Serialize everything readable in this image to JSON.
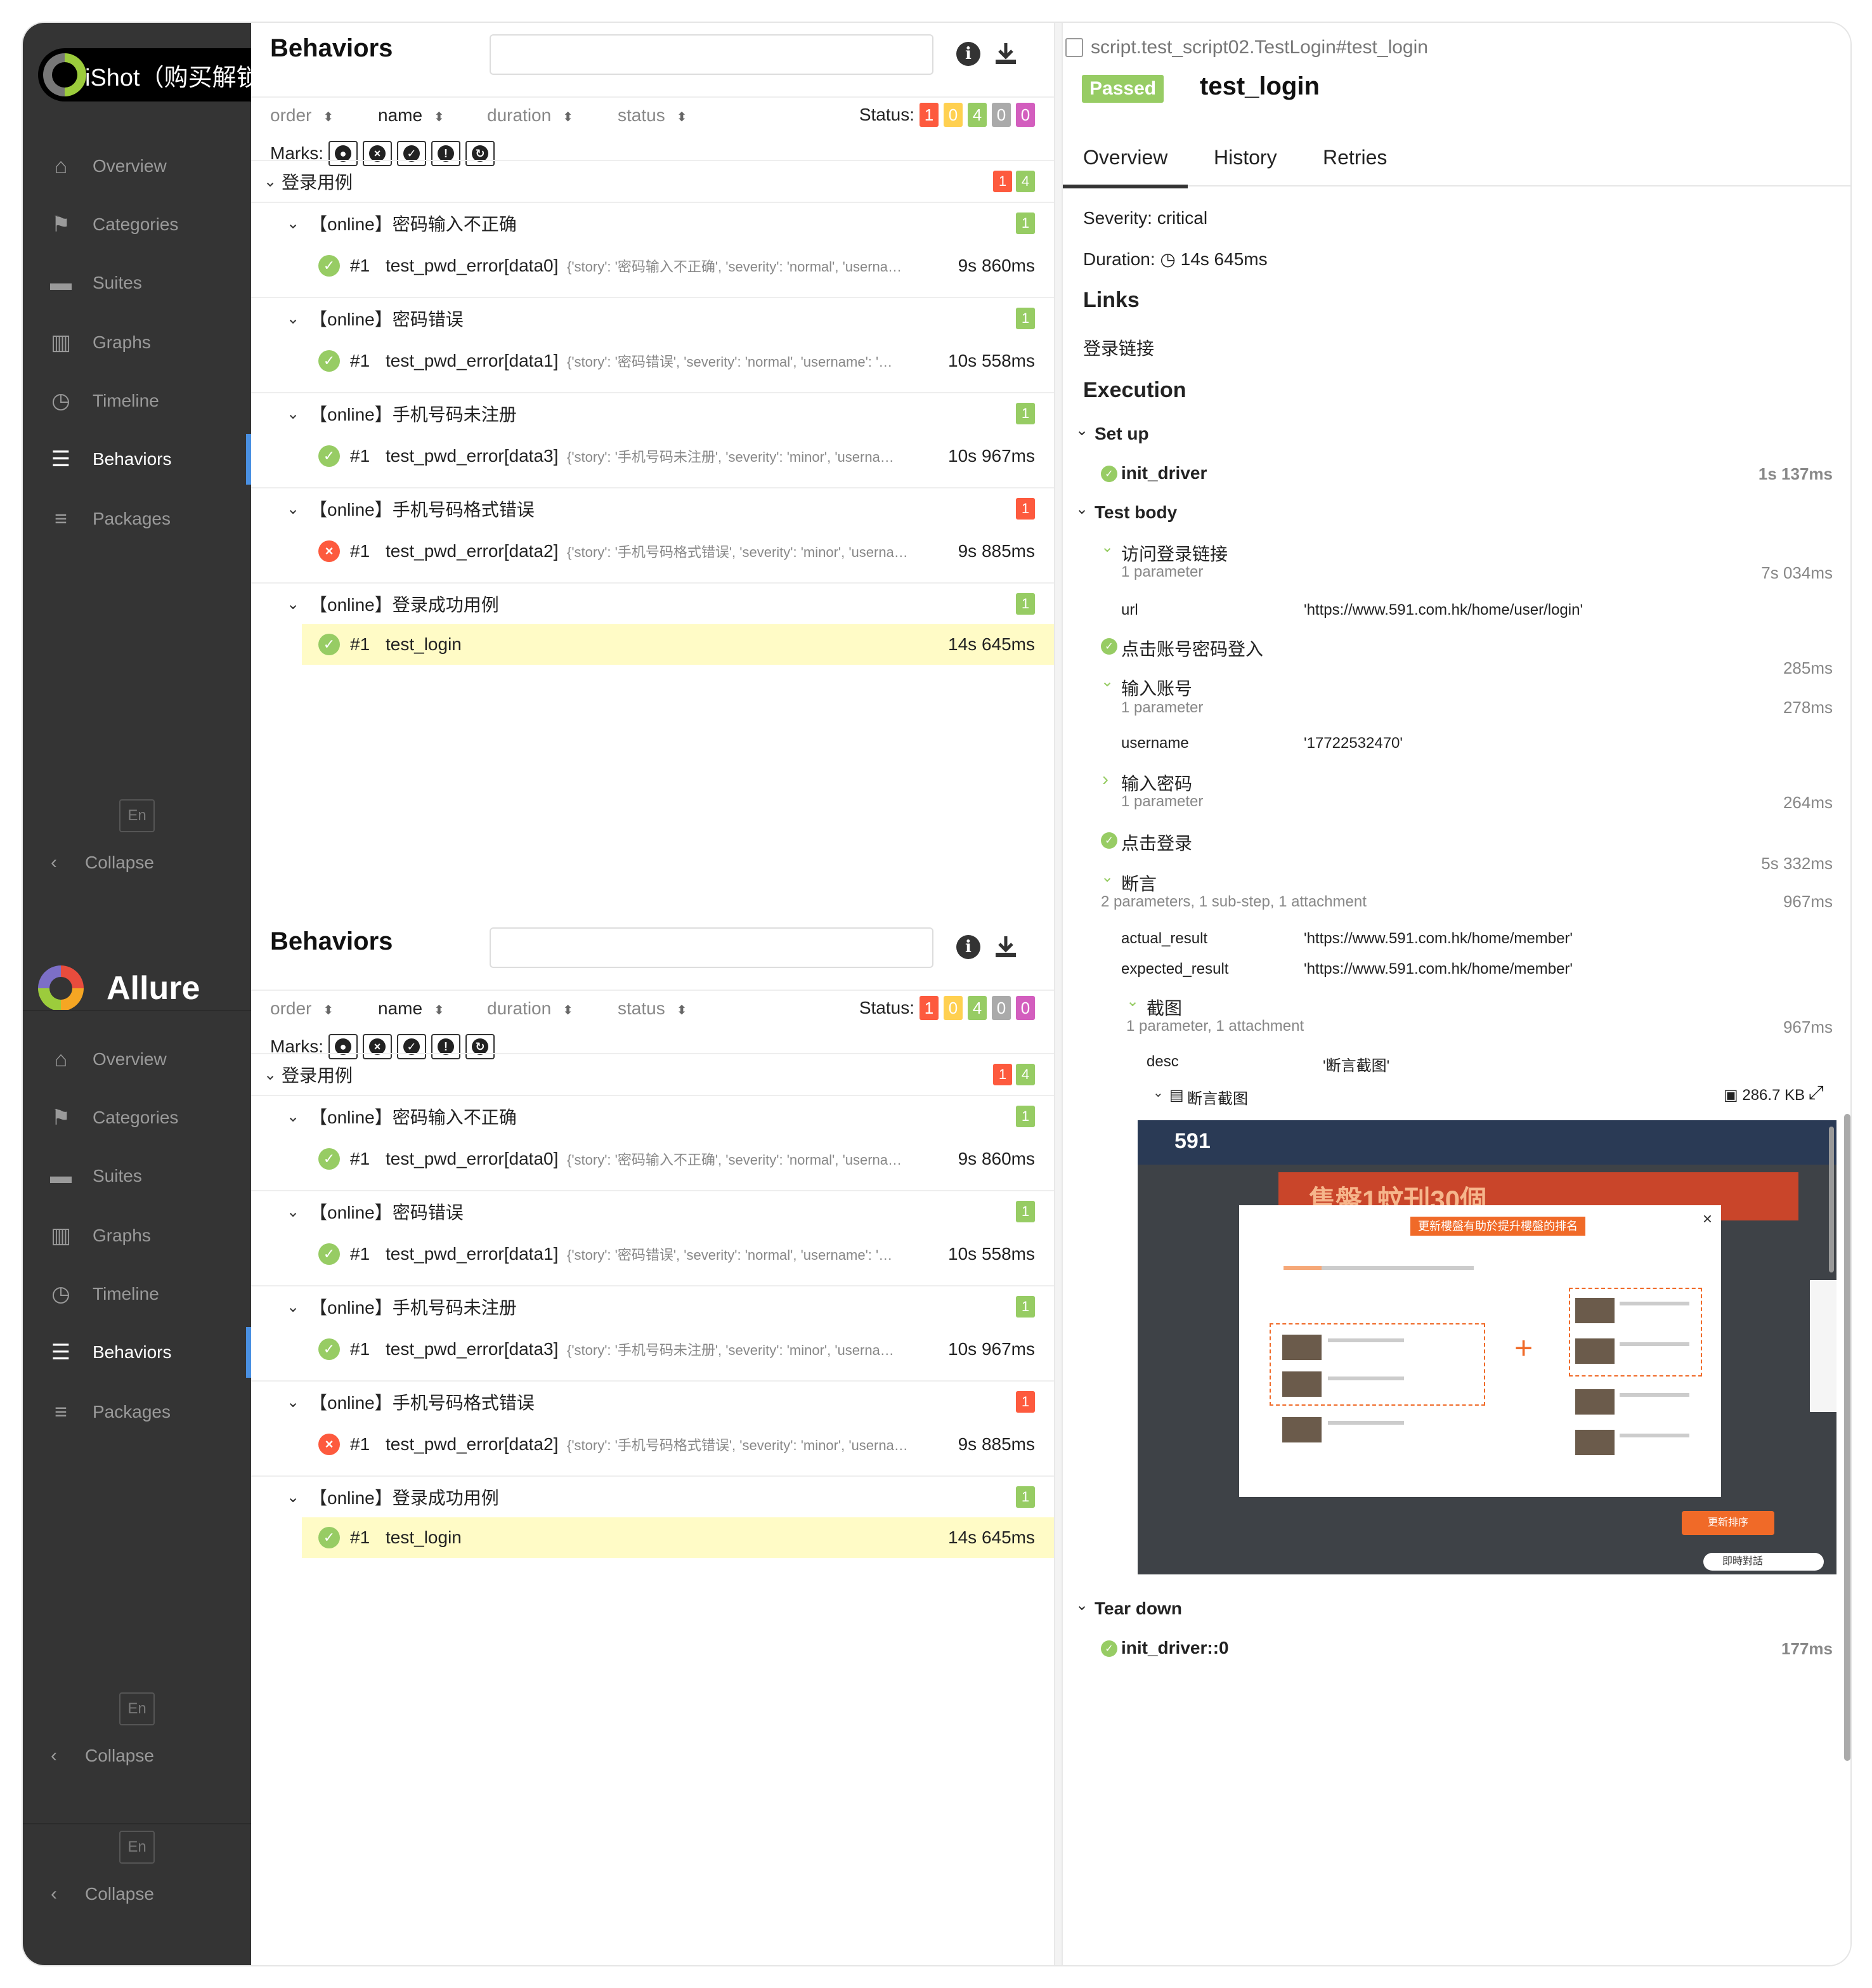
{
  "watermark": {
    "text": "iShot（购买解锁去水印）"
  },
  "sidebar": {
    "brand": "Allure",
    "lang": "En",
    "collapse": "Collapse",
    "items": [
      {
        "label": "Overview",
        "icon": "home-icon"
      },
      {
        "label": "Categories",
        "icon": "flag-icon"
      },
      {
        "label": "Suites",
        "icon": "briefcase-icon"
      },
      {
        "label": "Graphs",
        "icon": "bar-chart-icon"
      },
      {
        "label": "Timeline",
        "icon": "clock-icon"
      },
      {
        "label": "Behaviors",
        "icon": "list-icon",
        "active": true
      },
      {
        "label": "Packages",
        "icon": "align-left-icon"
      }
    ]
  },
  "behaviors": {
    "title": "Behaviors",
    "search_placeholder": "",
    "sort": {
      "order": "order",
      "name": "name",
      "duration": "duration",
      "status": "status"
    },
    "status_label": "Status:",
    "status_counts": [
      "1",
      "0",
      "4",
      "0",
      "0"
    ],
    "marks_label": "Marks:",
    "root": {
      "label": "登录用例",
      "fail": "1",
      "pass": "4"
    },
    "groups": [
      {
        "label": "【online】密码输入不正确",
        "count": "1",
        "count_type": "pass",
        "case": {
          "num": "#1",
          "name": "test_pwd_error[data0]",
          "params": "{'story': '密码输入不正确', 'severity': 'normal', 'userna…",
          "duration": "9s 860ms",
          "status": "passed"
        }
      },
      {
        "label": "【online】密码错误",
        "count": "1",
        "count_type": "pass",
        "case": {
          "num": "#1",
          "name": "test_pwd_error[data1]",
          "params": "{'story': '密码错误', 'severity': 'normal', 'username': '…",
          "duration": "10s 558ms",
          "status": "passed"
        }
      },
      {
        "label": "【online】手机号码未注册",
        "count": "1",
        "count_type": "pass",
        "case": {
          "num": "#1",
          "name": "test_pwd_error[data3]",
          "params": "{'story': '手机号码未注册', 'severity': 'minor', 'userna…",
          "duration": "10s 967ms",
          "status": "passed"
        }
      },
      {
        "label": "【online】手机号码格式错误",
        "count": "1",
        "count_type": "fail",
        "case": {
          "num": "#1",
          "name": "test_pwd_error[data2]",
          "params": "{'story': '手机号码格式错误', 'severity': 'minor', 'userna…",
          "duration": "9s 885ms",
          "status": "failed"
        }
      },
      {
        "label": "【online】登录成功用例",
        "count": "1",
        "count_type": "pass",
        "case": {
          "num": "#1",
          "name": "test_login",
          "params": "",
          "duration": "14s 645ms",
          "status": "passed",
          "selected": true
        }
      }
    ]
  },
  "detail": {
    "breadcrumb": "script.test_script02.TestLogin#test_login",
    "status_badge": "Passed",
    "title": "test_login",
    "tabs": [
      "Overview",
      "History",
      "Retries"
    ],
    "severity": "Severity: critical",
    "duration_label": "Duration:",
    "duration": "14s 645ms",
    "links_heading": "Links",
    "link_text": "登录链接",
    "execution_heading": "Execution",
    "setup": {
      "label": "Set up",
      "step": "init_driver",
      "duration": "1s 137ms"
    },
    "test_body": "Test body",
    "steps": {
      "visit": {
        "label": "访问登录链接",
        "sub": "1 parameter",
        "duration": "7s 034ms",
        "param_name": "url",
        "param_value": "'https://www.591.com.hk/home/user/login'"
      },
      "click_account": {
        "label": "点击账号密码登入",
        "duration": "285ms"
      },
      "input_account": {
        "label": "输入账号",
        "sub": "1 parameter",
        "duration": "278ms",
        "param_name": "username",
        "param_value": "'17722532470'"
      },
      "input_password": {
        "label": "输入密码",
        "sub": "1 parameter",
        "duration": "264ms"
      },
      "click_login": {
        "label": "点击登录",
        "duration": "5s 332ms"
      },
      "assert": {
        "label": "断言",
        "sub": "2 parameters, 1 sub-step, 1 attachment",
        "duration": "967ms",
        "p1_name": "actual_result",
        "p1_value": "'https://www.591.com.hk/home/member'",
        "p2_name": "expected_result",
        "p2_value": "'https://www.591.com.hk/home/member'"
      },
      "screenshot": {
        "label": "截图",
        "sub": "1 parameter, 1 attachment",
        "duration": "967ms",
        "param_name": "desc",
        "param_value": "'断言截图'"
      },
      "attachment": {
        "label": "断言截图",
        "size": "286.7 KB"
      }
    },
    "attachment_image": {
      "logo": "591",
      "banner": "售盤1蚊刊30個",
      "modal_title": "更新樓盤有助於提升樓盤的排名",
      "button": "更新排序",
      "chat": "即時對話"
    },
    "teardown": {
      "label": "Tear down",
      "step": "init_driver::0",
      "duration": "177ms"
    }
  }
}
